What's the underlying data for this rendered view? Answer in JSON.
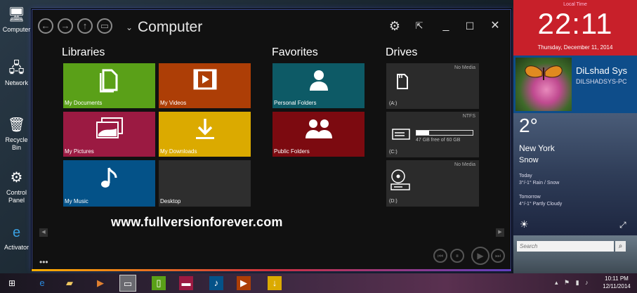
{
  "desktop": {
    "icons": [
      {
        "label": "Computer",
        "icon": "computer-icon"
      },
      {
        "label": "Network",
        "icon": "network-icon"
      },
      {
        "label": "Recycle Bin",
        "icon": "recycle-bin-icon"
      },
      {
        "label": "Control Panel",
        "icon": "control-panel-icon"
      },
      {
        "label": "Activator",
        "icon": "activator-icon"
      }
    ]
  },
  "window": {
    "title": "Computer",
    "sections": {
      "libraries": "Libraries",
      "favorites": "Favorites",
      "drives": "Drives"
    },
    "libraries": [
      {
        "label": "My Documents",
        "color": "#5aa018",
        "icon": "documents-icon"
      },
      {
        "label": "My Videos",
        "color": "#ad3e06",
        "icon": "video-icon"
      },
      {
        "label": "My Pictures",
        "color": "#9b1a42",
        "icon": "pictures-icon"
      },
      {
        "label": "My Downloads",
        "color": "#dbaa00",
        "icon": "download-icon"
      },
      {
        "label": "My Music",
        "color": "#045288",
        "icon": "music-icon"
      },
      {
        "label": "Desktop",
        "color": "#2e2e2e",
        "icon": ""
      }
    ],
    "favorites": [
      {
        "label": "Personal Folders",
        "color": "#0d5a66",
        "icon": "person-icon"
      },
      {
        "label": "Public Folders",
        "color": "#7c0a10",
        "icon": "group-icon"
      }
    ],
    "drives": [
      {
        "label": "(A:)",
        "fs": "No Media",
        "icon": "floppy-icon",
        "free": "",
        "used_fraction": null
      },
      {
        "label": "(C:)",
        "fs": "NTFS",
        "icon": "hard-drive-icon",
        "free": "47 GB free of 60 GB",
        "used_fraction": 0.22
      },
      {
        "label": "(D:)",
        "fs": "No Media",
        "icon": "cd-drive-icon",
        "free": "",
        "used_fraction": null
      }
    ],
    "watermark": "www.fullversionforever.com",
    "more": "•••"
  },
  "sidebar": {
    "clock": {
      "caption": "Local Time",
      "time": "22:11",
      "date": "Thursday, December 11, 2014"
    },
    "user": {
      "name": "DiLshad Sys",
      "pc": "DILSHADSYS-PC"
    },
    "weather": {
      "temp": "2°",
      "city": "New York",
      "cond": "Snow",
      "today_label": "Today",
      "today": "3°/-1° Rain / Snow",
      "tomorrow_label": "Tomorrow",
      "tomorrow": "4°/-1° Partly Cloudy"
    },
    "search_placeholder": "Search"
  },
  "taskbar": {
    "time": "10:11 PM",
    "date": "12/11/2014",
    "apps": [
      {
        "icon": "ie-icon",
        "color": "#2a8ae0"
      },
      {
        "icon": "folder-icon",
        "color": "#f0c860"
      },
      {
        "icon": "media-player-icon",
        "color": "#e08030"
      },
      {
        "icon": "computer-icon",
        "color": "#ffffff"
      },
      {
        "icon": "documents-icon",
        "color": "#5aa018"
      },
      {
        "icon": "pictures-icon",
        "color": "#9b1a42"
      },
      {
        "icon": "music-icon",
        "color": "#045288"
      },
      {
        "icon": "video-icon",
        "color": "#ad3e06"
      },
      {
        "icon": "download-icon",
        "color": "#dbaa00"
      }
    ]
  }
}
